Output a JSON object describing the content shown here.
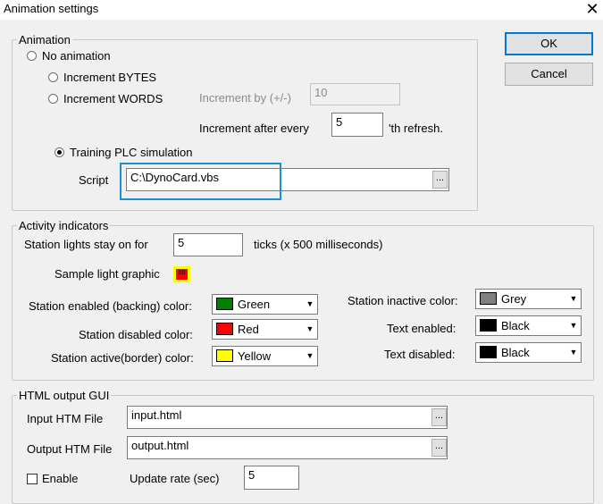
{
  "window": {
    "title": "Animation settings"
  },
  "buttons": {
    "ok": "OK",
    "cancel": "Cancel",
    "browse": "..."
  },
  "animation": {
    "group_label": "Animation",
    "no_animation": "No animation",
    "increment_bytes": "Increment BYTES",
    "increment_words": "Increment WORDS",
    "increment_by_label": "Increment by (+/-)",
    "increment_by_value": "10",
    "increment_after_label": "Increment after every",
    "increment_after_value": "5",
    "refresh_suffix": "'th refresh.",
    "training_plc": "Training PLC simulation",
    "script_label": "Script",
    "script_value": "C:\\DynoCard.vbs",
    "selected": "training_plc"
  },
  "activity": {
    "group_label": "Activity indicators",
    "stay_on_label": "Station lights stay on for",
    "stay_on_value": "5",
    "stay_on_suffix": "ticks (x 500 milliseconds)",
    "sample_label": "Sample light graphic",
    "sample_text": "00",
    "enabled_label": "Station enabled (backing) color:",
    "enabled_value": "Green",
    "enabled_color": "#008000",
    "disabled_label": "Station disabled color:",
    "disabled_value": "Red",
    "disabled_color": "#ff0000",
    "active_label": "Station active(border) color:",
    "active_value": "Yellow",
    "active_color": "#ffff00",
    "inactive_label": "Station inactive color:",
    "inactive_value": "Grey",
    "inactive_color": "#808080",
    "text_enabled_label": "Text enabled:",
    "text_enabled_value": "Black",
    "text_enabled_color": "#000000",
    "text_disabled_label": "Text disabled:",
    "text_disabled_value": "Black",
    "text_disabled_color": "#000000"
  },
  "html_output": {
    "group_label": "HTML output GUI",
    "input_label": "Input HTM File",
    "input_value": "input.html",
    "output_label": "Output HTM File",
    "output_value": "output.html",
    "enable_label": "Enable",
    "enable_checked": false,
    "update_label": "Update rate (sec)",
    "update_value": "5"
  }
}
